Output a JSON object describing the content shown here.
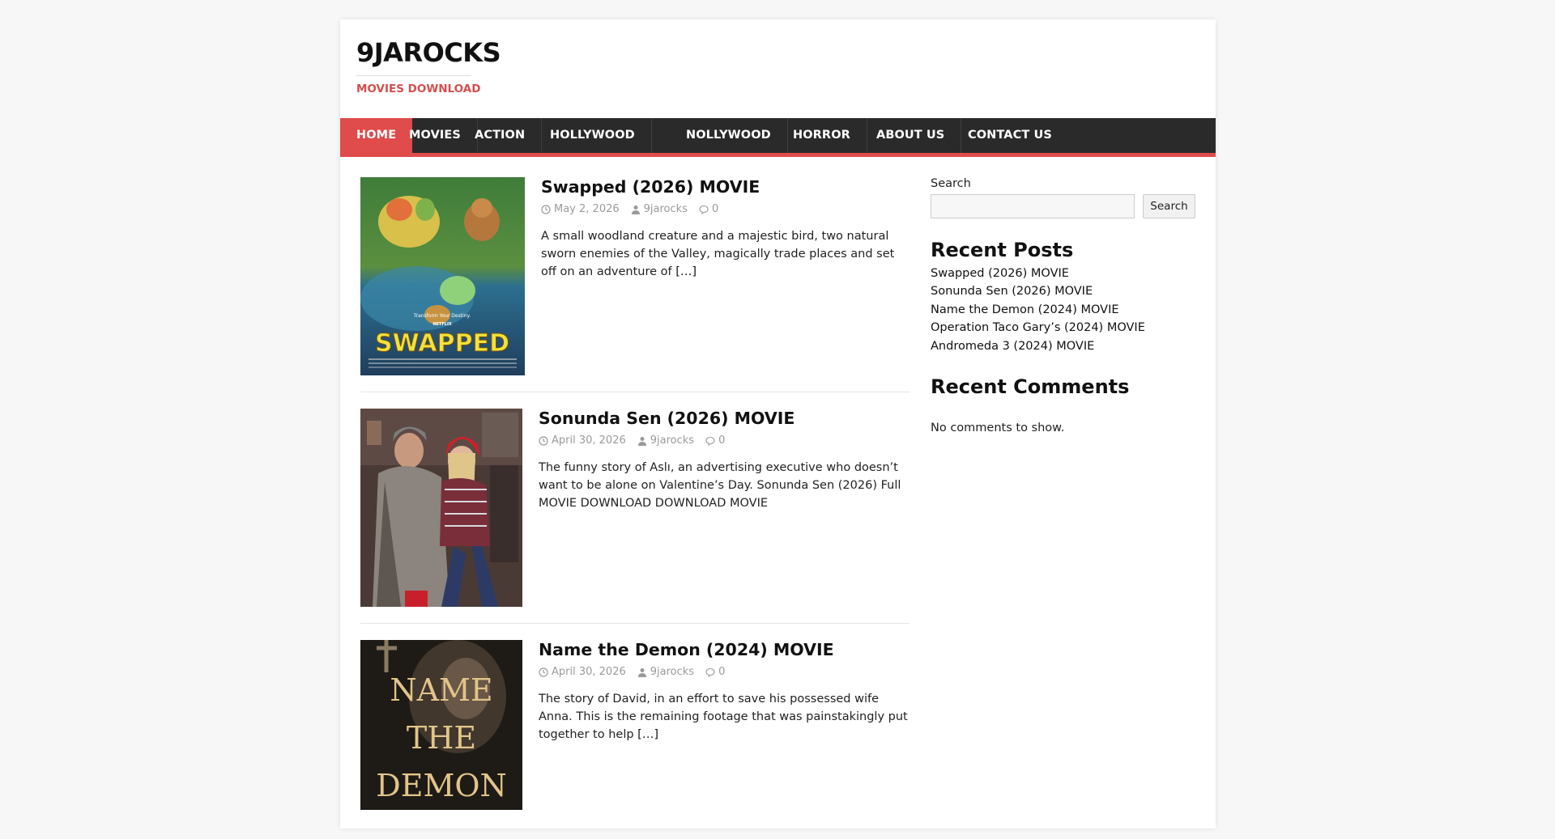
{
  "site": {
    "title": "9JAROCKS",
    "tagline": "MOVIES DOWNLOAD"
  },
  "nav": {
    "items": [
      {
        "label": "HOME",
        "active": true
      },
      {
        "label": "MOVIES"
      },
      {
        "label": "ACTION"
      },
      {
        "label": "HOLLYWOOD"
      },
      {
        "label": "NOLLYWOOD"
      },
      {
        "label": "HORROR"
      },
      {
        "label": "ABOUT US"
      },
      {
        "label": "CONTACT US"
      }
    ]
  },
  "posts": [
    {
      "title": "Swapped (2026) MOVIE",
      "date": "May 2, 2026",
      "author": "9jarocks",
      "comments": "0",
      "excerpt": "A small woodland creature and a majestic bird, two natural sworn enemies of the Valley, magically trade places and set off on an adventure of",
      "read_more": "[…]",
      "poster": {
        "tagline": "Transform Your Destiny.",
        "studio": "NETFLIX",
        "title": "SWAPPED"
      }
    },
    {
      "title": "Sonunda Sen (2026) MOVIE",
      "date": "April 30, 2026",
      "author": "9jarocks",
      "comments": "0",
      "excerpt": "The funny story of Aslı, an advertising executive who doesn’t want to be alone on Valentine’s Day. Sonunda Sen (2026) Full MOVIE DOWNLOAD DOWNLOAD MOVIE",
      "read_more": ""
    },
    {
      "title": "Name the Demon (2024) MOVIE",
      "date": "April 30, 2026",
      "author": "9jarocks",
      "comments": "0",
      "excerpt": "The story of David, in an effort to save his possessed wife Anna. This is the remaining footage that was painstakingly put together to help",
      "read_more": "[…]",
      "poster": {
        "title_lines": [
          "NAME",
          "THE",
          "DEMON"
        ]
      }
    }
  ],
  "sidebar": {
    "search_label": "Search",
    "search_placeholder": "",
    "search_button": "Search",
    "recent_posts_title": "Recent Posts",
    "recent_posts": [
      "Swapped (2026) MOVIE",
      "Sonunda Sen (2026) MOVIE",
      "Name the Demon (2024) MOVIE",
      "Operation Taco Gary’s (2024) MOVIE",
      "Andromeda 3 (2024) MOVIE"
    ],
    "recent_comments_title": "Recent Comments",
    "no_comments": "No comments to show."
  },
  "colors": {
    "accent": "#e04b4b",
    "nav_bg": "#2a2a2a",
    "tagline": "#d54e4e",
    "meta": "#9a9a9a"
  },
  "icons": {
    "date": "clock-icon",
    "author": "user-icon",
    "comments": "comment-icon"
  }
}
